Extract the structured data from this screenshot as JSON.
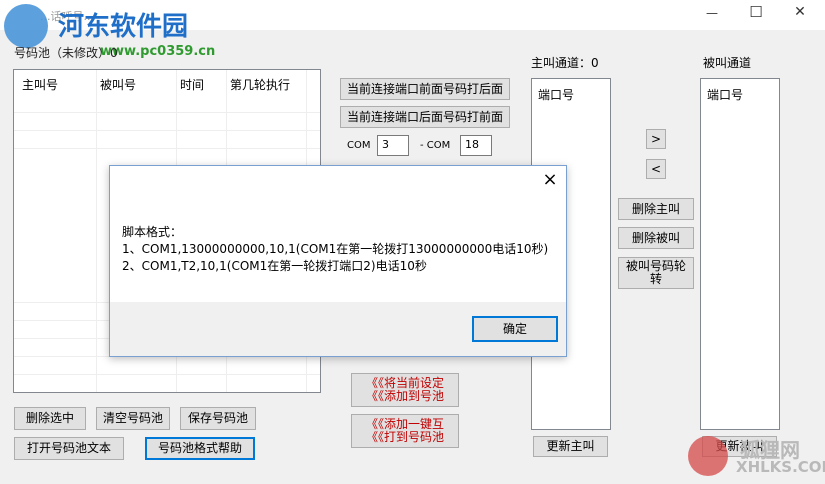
{
  "watermark_top": {
    "title": "河东软件园",
    "url": "www.pc0359.cn"
  },
  "watermark_bottom": {
    "title": "狐狸网",
    "url": "XHLKS.COM"
  },
  "window": {
    "title": "...话呼号..."
  },
  "pool": {
    "label": "号码池（未修改）0",
    "columns": [
      "主叫号",
      "被叫号",
      "时间",
      "第几轮执行"
    ],
    "buttons": {
      "delete": "删除选中",
      "clear": "清空号码池",
      "save": "保存号码池",
      "open": "打开号码池文本",
      "help": "号码池格式帮助"
    }
  },
  "middle": {
    "btn_front": "当前连接端口前面号码打后面",
    "btn_back": "当前连接端口后面号码打前面",
    "com_label_a": "COM",
    "com_from": "3",
    "com_label_b": "- COM",
    "com_to": "18",
    "btn_add_pool": "《《将当前设定\n《《添加到号池",
    "btn_add_one": "《《添加一键互\n《《打到号码池"
  },
  "caller": {
    "label": "主叫通道：0",
    "column": "端口号",
    "refresh": "更新主叫"
  },
  "callee": {
    "label": "被叫通道",
    "column": "端口号",
    "refresh": "更新被叫"
  },
  "right_controls": {
    "right": ">",
    "left": "<",
    "del_caller": "删除主叫",
    "del_callee": "删除被叫",
    "rotate": "被叫号码轮\n转"
  },
  "dialog": {
    "line1": "脚本格式：",
    "line2": "1、COM1,13000000000,10,1(COM1在第一轮拨打13000000000电话10秒)",
    "line3": "2、COM1,T2,10,1(COM1在第一轮拨打端口2)电话10秒",
    "ok": "确定",
    "close": "×"
  },
  "titlebar": {
    "minimize": "—",
    "maximize": "☐",
    "close": "✕"
  }
}
